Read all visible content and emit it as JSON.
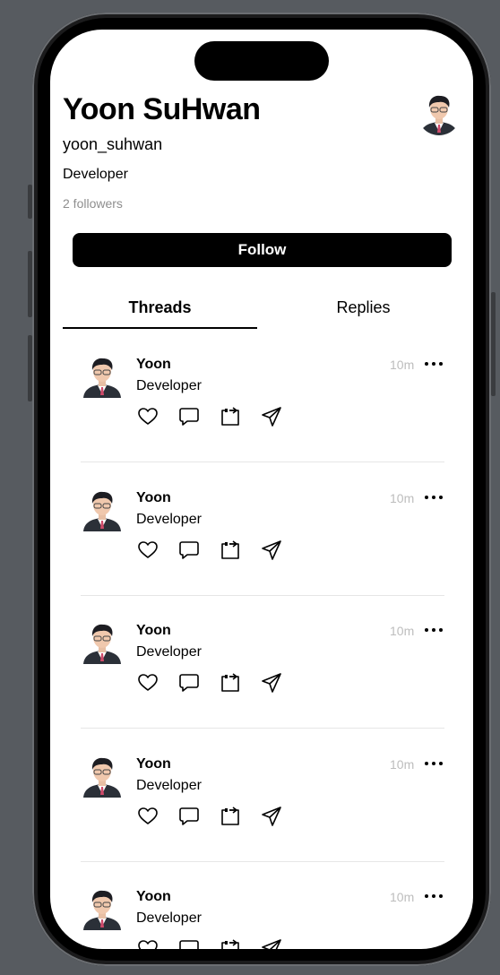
{
  "profile": {
    "name": "Yoon SuHwan",
    "username": "yoon_suhwan",
    "bio": "Developer",
    "followers": "2 followers",
    "follow_label": "Follow"
  },
  "tabs": [
    {
      "label": "Threads",
      "active": true
    },
    {
      "label": "Replies",
      "active": false
    }
  ],
  "threads": [
    {
      "author": "Yoon",
      "content": "Developer",
      "time": "10m"
    },
    {
      "author": "Yoon",
      "content": "Developer",
      "time": "10m"
    },
    {
      "author": "Yoon",
      "content": "Developer",
      "time": "10m"
    },
    {
      "author": "Yoon",
      "content": "Developer",
      "time": "10m"
    },
    {
      "author": "Yoon",
      "content": "Developer",
      "time": "10m"
    }
  ],
  "icons": {
    "like": "heart-icon",
    "reply": "comment-icon",
    "repost": "repost-icon",
    "share": "paper-plane-icon",
    "more": "ellipsis-icon"
  },
  "colors": {
    "background": "#575b60",
    "screen": "#ffffff",
    "primary": "#000000",
    "muted": "#8e8e8e",
    "time": "#bdbdbd",
    "separator": "#e6e6e6"
  }
}
